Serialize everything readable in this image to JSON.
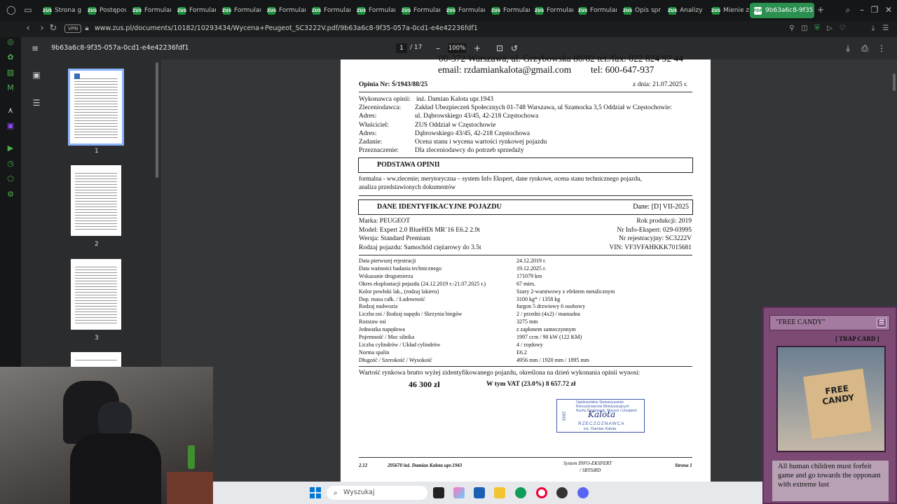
{
  "tabs": [
    {
      "label": "Strona gł",
      "x": 0
    },
    {
      "label": "Postępow",
      "x": 0
    },
    {
      "label": "Formular",
      "x": 0
    },
    {
      "label": "Formular",
      "x": 0
    },
    {
      "label": "Formular",
      "x": 0
    },
    {
      "label": "Formular",
      "x": 0
    },
    {
      "label": "Formular",
      "x": 0
    },
    {
      "label": "Formular",
      "x": 0
    },
    {
      "label": "Formular",
      "x": 0
    },
    {
      "label": "Formular",
      "x": 0
    },
    {
      "label": "Formular",
      "x": 0
    },
    {
      "label": "Formular",
      "x": 0
    },
    {
      "label": "Formular",
      "x": 0
    },
    {
      "label": "Opis spr",
      "x": 0
    },
    {
      "label": "Analizy",
      "x": 0
    },
    {
      "label": "Mienie z",
      "x": 0
    }
  ],
  "active_tab": "9b63a6c8-9f35",
  "address": {
    "vpn": "VPN",
    "url": "www.zus.pl/documents/10182/10293434/Wycena+Peugeot_SC3222V.pdf/9b63a6c8-9f35-057a-0cd1-e4e42236fdf1"
  },
  "pdf": {
    "title": "9b63a6c8-9f35-057a-0cd1-e4e42236fdf1",
    "page_current": "1",
    "page_total": "/ 17",
    "zoom": "100%",
    "thumbs": [
      "1",
      "2",
      "3"
    ]
  },
  "doc": {
    "contact_top": "00-372 Warszawa, ul. Grzybowska 80/82 tel./fax: 022 824 92 44",
    "email": "email: rzdamiankalota@gmail.com",
    "tel": "tel: 600-647-937",
    "opinia": "Opinia Nr: Ś/1943/88/25",
    "date": "z dnia:  21.07.2025 r.",
    "info_rows": [
      {
        "label": "Wykonawca opinii:",
        "value": "inż. Damian  Kalota upr.1943"
      },
      {
        "label": "Zleceniodawca:",
        "value": "Zakład Ubezpieczeń Społecznych 01-748 Warszawa, ul Szamocka 3,5 Oddział w Częstochowie:"
      },
      {
        "label": "Adres:",
        "value": "ul. Dąbrowskiego 43/45,  42-218 Częstochowa"
      },
      {
        "label": "Właściciel:",
        "value": "ZUS Oddział w Częstochowie"
      },
      {
        "label": "Adres:",
        "value": "Dąbrowskiego 43/45,  42-218 Częstochowa"
      },
      {
        "label": "Zadanie:",
        "value": "Ocena stanu i wycena wartości rynkowej pojazdu"
      },
      {
        "label": "Przeznaczenie:",
        "value": "Dla zleceniodawcy do potrzeb sprzedaży"
      }
    ],
    "podstawa_header": "PODSTAWA OPINII",
    "podstawa_text1": "formalna - ww.zlecenie; merytoryczna – system Info Ekspert, dane rynkowe, ocena stanu technicznego pojazdu,",
    "podstawa_text2": "analiza przedstawionych dokumentów",
    "dane_header": "DANE IDENTYFIKACYJNE POJAZDU",
    "dane_date": "Dane: [D] VII-2025",
    "vehicle_left": [
      "Marka:   PEUGEOT",
      "Model:   Expert 2.0 BlueHDi MR`16 E6.2 2.9t",
      "Wersja:  Standard Premium",
      "Rodzaj pojazdu:  Samochód ciężarowy do 3.5t"
    ],
    "vehicle_right": [
      "Rok produkcji:  2019",
      "Nr Info-Ekspert:  029-03995",
      "Nr rejestracyjny:  SC3222V",
      "VIN:  VF3VFAHKKK7015681"
    ],
    "spec_rows": [
      {
        "k": "Data pierwszej rejestracji",
        "v": "24.12.2019  r."
      },
      {
        "k": "Data ważności badania technicznego",
        "v": "19.12.2025  r."
      },
      {
        "k": "Wskazanie drogomierza",
        "v": "171079 km"
      },
      {
        "k": "Okres eksploatacji pojazdu (24.12.2019 r.-21.07.2025 r.)",
        "v": "67 mies."
      },
      {
        "k": "Kolor powłoki lak., (rodzaj lakieru)",
        "v": "Szary 2-warstwowy z efektem metalicznym"
      },
      {
        "k": "Dop. masa całk.  /  Ładowność",
        "v": "3100 kg*  /  1358 kg"
      },
      {
        "k": "Rodzaj nadwozia",
        "v": "furgon 5 drzwiowy 6 osobowy"
      },
      {
        "k": "Liczba osi  /  Rodzaj napędu  /  Skrzynia biegów",
        "v": "2  /  przedni  (4x2)  /  manualna"
      },
      {
        "k": "Rozstaw osi",
        "v": "3275 mm"
      },
      {
        "k": "Jednostka napędowa",
        "v": "z zapłonem samoczynnym"
      },
      {
        "k": "Pojemność  /  Moc silnika",
        "v": "1997 ccm  /  90 kW (122 KM)"
      },
      {
        "k": "Liczba cylindrów  /  Układ cylindrów",
        "v": "4  /  rzędowy"
      },
      {
        "k": "Norma spalin",
        "v": "E6.2"
      },
      {
        "k": "Długość  /  Szerokość  /  Wysokość",
        "v": "4956 mm  /  1920 mm  /  1895 mm"
      }
    ],
    "value_text": "Wartość rynkowa brutto  wyżej zidentyfikowanego pojazdu, określona na dzień wykonania opinii wynosi:",
    "value_amount": "46 300 zł",
    "vat_text": "W tym VAT (23.0%) 8 657.72 zł",
    "stamp_lines": [
      "Ogólnopolskie Stowarzyszenie",
      "Rzeczoznawców Motoryzacyjnych",
      "Ruchu Drogowego, Maszyn i Urządzeń",
      "1943",
      "RZECZOZNAWCA",
      "inż. Damian Kalota"
    ],
    "footer_left": "2.12",
    "footer_mid": "205670 inż. Damian  Kalota upr.1943",
    "footer_sys1": "System INFO-EKSPERT",
    "footer_sys2": "/ SRTSiRD",
    "footer_page": "Strona 1"
  },
  "card": {
    "title": "\"FREE CANDY\"",
    "type": "[ TRAP CARD ]",
    "box_text": "FREE CANDY",
    "desc": "All human children must forfeit game and go towards the opponant with extreme lust"
  },
  "taskbar": {
    "search_placeholder": "Wyszukaj"
  }
}
